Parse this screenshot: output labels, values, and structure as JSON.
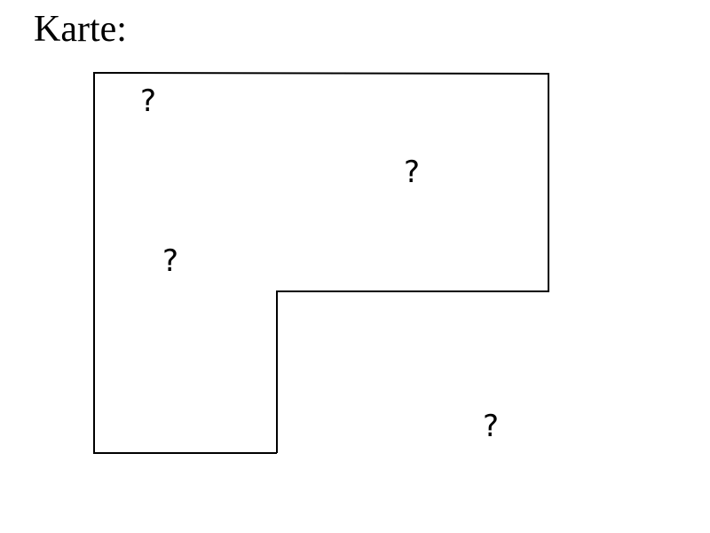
{
  "title": "Karte:",
  "map": {
    "outline_color": "#000000",
    "labels": [
      {
        "id": "label-1",
        "text": "?"
      },
      {
        "id": "label-2",
        "text": "?"
      },
      {
        "id": "label-3",
        "text": "?"
      },
      {
        "id": "label-4",
        "text": "?"
      }
    ]
  }
}
